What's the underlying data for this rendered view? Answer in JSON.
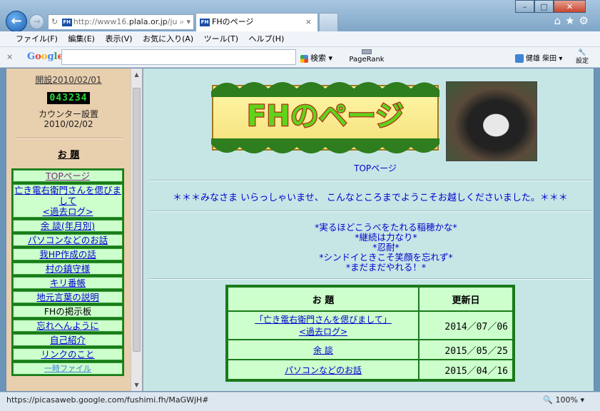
{
  "window": {
    "minimize": "–",
    "maximize": "□",
    "close": "✕"
  },
  "browser": {
    "address_host_prefix": "http://www16.",
    "address_host_bold": "plala.or.jp",
    "address_tail": "/ju",
    "address_search": "⌕ ▾",
    "address_refresh": "↻",
    "favicon": "FH",
    "tab_title": "FHのページ",
    "tab_close": "×",
    "top_icons": "⌂★⚙",
    "back": "←",
    "forward": "→"
  },
  "menubar": {
    "items": [
      "ファイル(F)",
      "編集(E)",
      "表示(V)",
      "お気に入り(A)",
      "ツール(T)",
      "ヘルプ(H)"
    ]
  },
  "google_toolbar": {
    "close": "×",
    "logo": "Google",
    "search_label": "検索",
    "pagerank_label": "PageRank",
    "user_label": "健雄 柴田",
    "settings_label": "設定"
  },
  "sidebar": {
    "established": "開設2010/02/01",
    "counter": "043234",
    "counter_label_1": "カウンター設置",
    "counter_label_2": "2010/02/02",
    "topics_title": "お 題",
    "menu": [
      "TOPページ",
      "亡き電右衛門さんを偲びまして",
      "<過去ログ>",
      "余 談(年月別)",
      "パソコンなどのお話",
      "我HP作成の話",
      "村の鎮守様",
      "キリ番帳",
      "地元言葉の説明",
      "FHの掲示板",
      "忘れへんように",
      "自己紹介",
      "リンクのこと",
      "一時ファイル"
    ]
  },
  "main": {
    "logo_text": "FHのページ",
    "top_label": "TOPページ",
    "welcome": "＊＊＊みなさま いらっしゃいませ、 こんなところまでようこそお越しくださいました。＊＊＊",
    "mottos": [
      "*実るほどこうべをたれる稲穂かな*",
      "*継続は力なり*",
      "*忍耐*",
      "*シンドイときこそ笑顔を忘れず*",
      "*まだまだやれる！*"
    ],
    "table": {
      "header_topic": "お 題",
      "header_updated": "更新日",
      "rows": [
        {
          "topic_1": "「亡き電右衛門さんを偲びまして」",
          "topic_2": "<過去ログ>",
          "date": "2014／07／06"
        },
        {
          "topic_1": "余 談",
          "topic_2": "",
          "date": "2015／05／25"
        },
        {
          "topic_1": "パソコンなどのお話",
          "topic_2": "",
          "date": "2015／04／16"
        }
      ]
    }
  },
  "status": {
    "url": "https://picasaweb.google.com/fushimi.fh/MaGWjH#",
    "zoom": "100%"
  },
  "colors": {
    "sidebar_bg": "#e8cfae",
    "content_bg": "#c6e6e6",
    "menu_cell": "#ccffcc",
    "menu_border": "#1a7a1a",
    "link": "#0000cc",
    "counter_digits": "#2ad93a"
  }
}
